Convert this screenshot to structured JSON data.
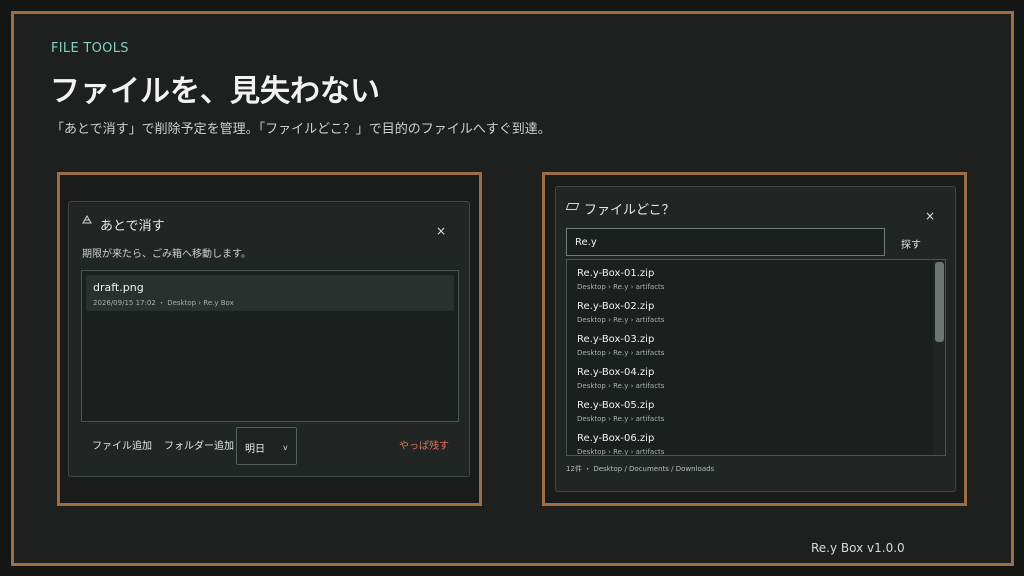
{
  "header": {
    "eyebrow": "FILE TOOLS",
    "title": "ファイルを、見失わない",
    "subtitle": "「あとで消す」で削除予定を管理。「ファイルどこ？」で目的のファイルへすぐ到達。"
  },
  "later_delete": {
    "title": "あとで消す",
    "icon": "recycle-icon",
    "description": "期限が来たら、ごみ箱へ移動します。",
    "files": [
      {
        "name": "draft.png",
        "meta": "2026/09/15 17:02 ・ Desktop › Re.y Box"
      }
    ],
    "add_file_label": "ファイル追加",
    "add_folder_label": "フォルダー追加",
    "schedule_value": "明日",
    "schedule_chevron": "v",
    "cancel_label": "やっぱ残す",
    "cancel_color": "#e0705b",
    "close": "×"
  },
  "finder": {
    "title": "ファイルどこ？",
    "icon": "tag-icon",
    "close": "×",
    "search_value": "Re.y",
    "search_button": "探す",
    "results": [
      {
        "name": "Re.y-Box-01.zip",
        "path": "Desktop › Re.y › artifacts"
      },
      {
        "name": "Re.y-Box-02.zip",
        "path": "Desktop › Re.y › artifacts"
      },
      {
        "name": "Re.y-Box-03.zip",
        "path": "Desktop › Re.y › artifacts"
      },
      {
        "name": "Re.y-Box-04.zip",
        "path": "Desktop › Re.y › artifacts"
      },
      {
        "name": "Re.y-Box-05.zip",
        "path": "Desktop › Re.y › artifacts"
      },
      {
        "name": "Re.y-Box-06.zip",
        "path": "Desktop › Re.y › artifacts"
      }
    ],
    "status": "12件 ・ Desktop / Documents / Downloads"
  },
  "footer": {
    "version": "Re.y Box  v1.0.0"
  },
  "colors": {
    "accent": "#7fd1c3",
    "frame": "#9c6e45",
    "background": "#1d201f"
  }
}
